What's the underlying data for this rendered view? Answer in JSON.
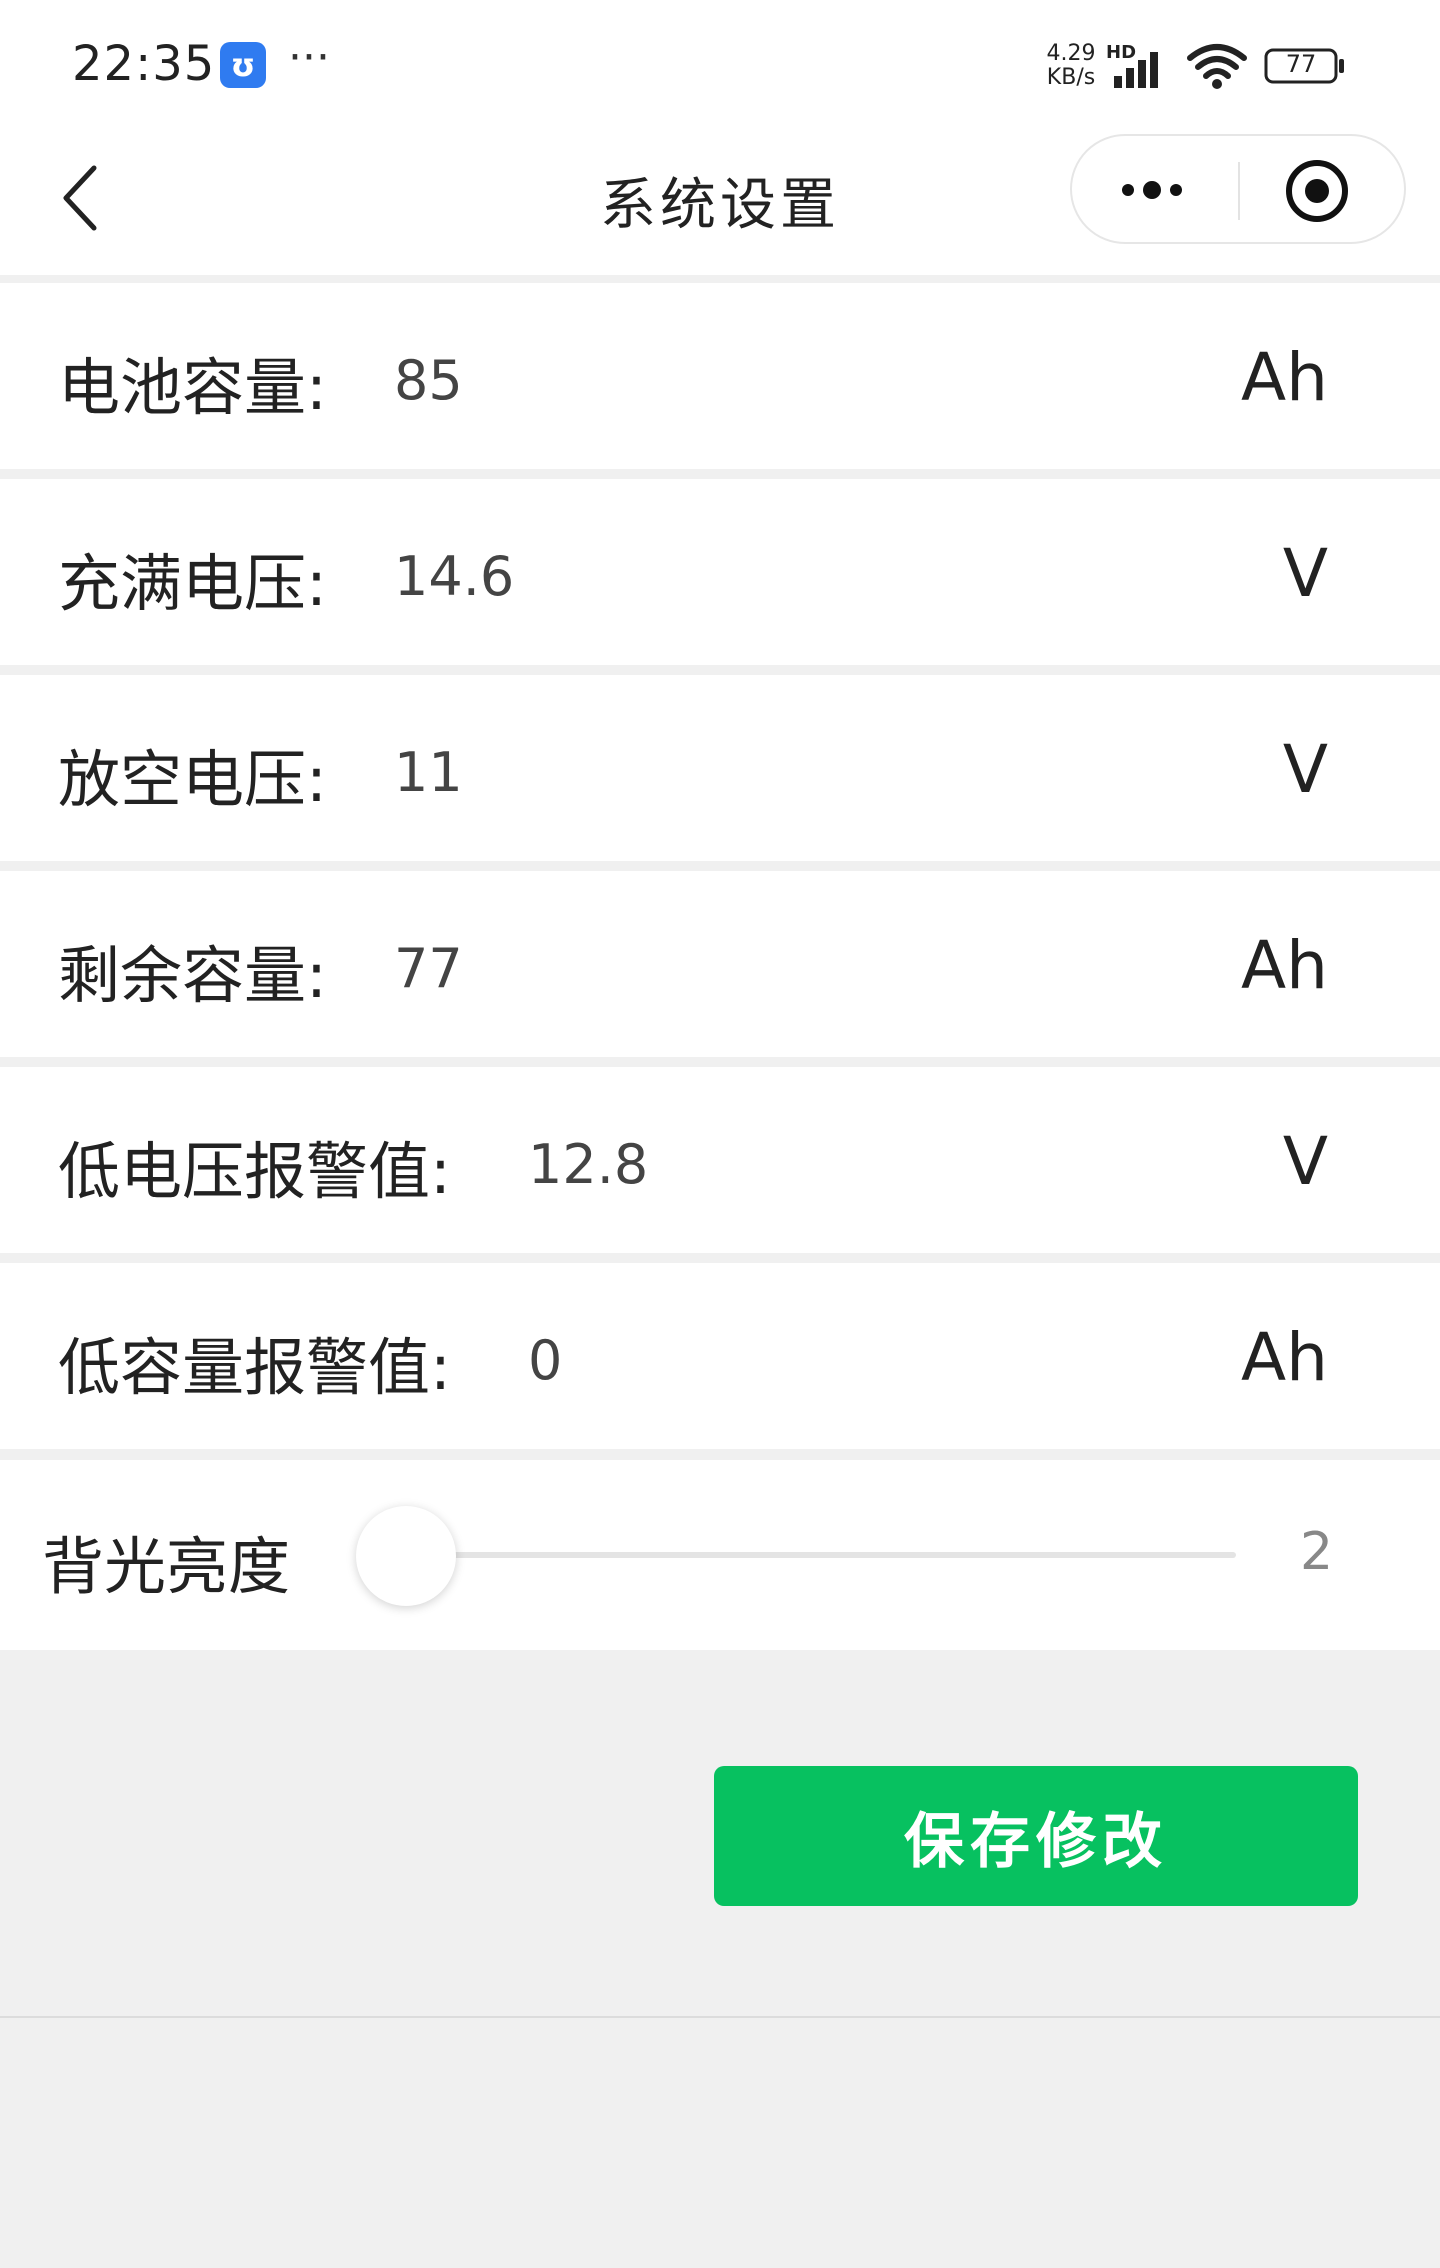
{
  "status_bar": {
    "time": "22:35",
    "app_icon_glyph": "ʊ",
    "more": "···",
    "net_speed_value": "4.29",
    "net_speed_unit": "KB/s",
    "network_label": "HD",
    "battery": "77",
    "icons": [
      "app-notification-icon",
      "signal-icon",
      "wifi-icon",
      "battery-icon"
    ]
  },
  "nav": {
    "title": "系统设置",
    "icons": [
      "back-icon",
      "more-dots-icon",
      "close-circle-icon"
    ]
  },
  "settings": [
    {
      "label": "电池容量:",
      "value": "85",
      "unit": "Ah"
    },
    {
      "label": "充满电压:",
      "value": "14.6",
      "unit": "V"
    },
    {
      "label": "放空电压:",
      "value": "11",
      "unit": "V"
    },
    {
      "label": "剩余容量:",
      "value": "77",
      "unit": "Ah"
    },
    {
      "label": "低电压报警值:",
      "value": "12.8",
      "unit": "V"
    },
    {
      "label": "低容量报警值:",
      "value": "0",
      "unit": "Ah"
    }
  ],
  "backlight": {
    "label": "背光亮度",
    "value": "2",
    "level": 0
  },
  "save_button": {
    "label": "保存修改"
  },
  "colors": {
    "accent": "#07c160",
    "app_icon": "#2f7bf0",
    "background": "#f0f0f0"
  }
}
